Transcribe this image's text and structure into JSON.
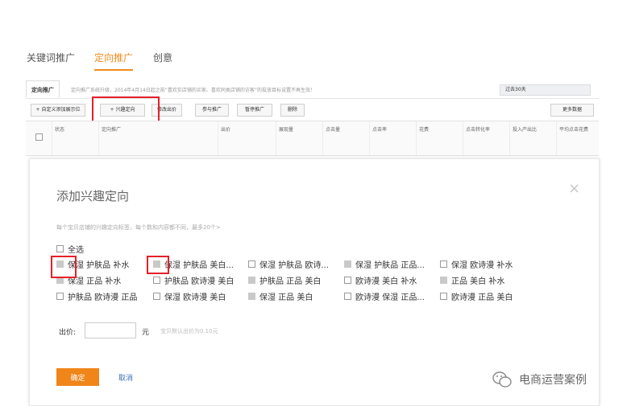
{
  "nav": {
    "tabs": [
      {
        "label": "关键词推广",
        "active": false
      },
      {
        "label": "定向推广",
        "active": true
      },
      {
        "label": "创意",
        "active": false
      }
    ]
  },
  "subhead": {
    "tab": "定向推广",
    "notice": "定向推广系统升级，2014年4月14日起之前“喜欢实店铺的买家、喜欢同类店铺的访客”的投放目标设置不再生效！",
    "range": "过去30天"
  },
  "toolbar": {
    "add_custom": "+ 自定义添加展示位",
    "add_interest": "+ 兴趣定向",
    "modify_bid": "修改出价",
    "join": "参与推广",
    "pause": "暂停推广",
    "delete": "删除",
    "more_data": "更多数据"
  },
  "table": {
    "headers": [
      "状态",
      "定向推广",
      "出价",
      "展现量",
      "点击量",
      "点击率",
      "花费",
      "点击转化率",
      "投入产出比",
      "平均点击花费"
    ]
  },
  "modal": {
    "title": "添加兴趣定向",
    "close": "×",
    "hint": "每个宝贝店铺的兴趣定向标签，每个数和内容都不同，最多20个>",
    "select_all": "全选",
    "options": [
      {
        "label": "保湿 护肤品 补水",
        "state": "gray"
      },
      {
        "label": "保湿 护肤品 美白...",
        "state": "gray"
      },
      {
        "label": "保湿 护肤品 欧诗...",
        "state": "empty"
      },
      {
        "label": "保湿 护肤品 正品...",
        "state": "gray"
      },
      {
        "label": "保湿 欧诗漫 补水",
        "state": "empty"
      },
      {
        "label": "保湿 正品 补水",
        "state": "gray"
      },
      {
        "label": "护肤品 欧诗漫 美白",
        "state": "empty"
      },
      {
        "label": "护肤品 正品 美白",
        "state": "gray"
      },
      {
        "label": "欧诗漫 美白 补水",
        "state": "empty"
      },
      {
        "label": "正品 美白 补水",
        "state": "gray"
      },
      {
        "label": "护肤品 欧诗漫 正品",
        "state": "empty"
      },
      {
        "label": "保湿 欧诗漫 美白",
        "state": "empty"
      },
      {
        "label": "保湿 正品 美白",
        "state": "gray"
      },
      {
        "label": "欧诗漫 保湿 正品...",
        "state": "empty"
      },
      {
        "label": "欧诗漫 正品 美白",
        "state": "empty"
      }
    ],
    "price_label": "出价:",
    "price_value": "",
    "unit": "元",
    "price_hint": "宝贝默认出价为0.10元",
    "ok": "确定",
    "cancel": "取消"
  },
  "watermark": "电商运营案例",
  "colors": {
    "accent": "#f08519",
    "highlight": "#e5202c",
    "link": "#3d6fb6"
  }
}
